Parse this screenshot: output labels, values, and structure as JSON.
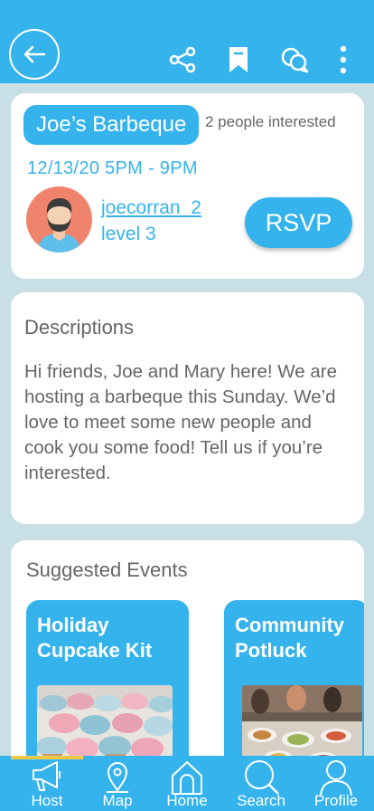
{
  "event": {
    "title": "Joe’s Barbeque",
    "interested": "2 people interested",
    "datetime": "12/13/20 5PM - 9PM",
    "host_username": "joecorran_2",
    "host_level": "level 3",
    "rsvp_label": "RSVP"
  },
  "description": {
    "heading": "Descriptions",
    "body": "Hi friends, Joe and Mary here! We are hosting a barbeque this Sunday. We’d love to meet some new people and cook you some food! Tell us if you’re interested."
  },
  "suggested": {
    "heading": "Suggested Events",
    "items": [
      {
        "title": "Holiday Cupcake Kit"
      },
      {
        "title": "Community Potluck"
      }
    ]
  },
  "nav": {
    "items": [
      {
        "label": "Host",
        "icon": "megaphone-icon"
      },
      {
        "label": "Map",
        "icon": "map-pin-icon"
      },
      {
        "label": "Home",
        "icon": "home-icon"
      },
      {
        "label": "Search",
        "icon": "search-icon"
      },
      {
        "label": "Profile",
        "icon": "profile-icon"
      }
    ],
    "active": "Host"
  },
  "colors": {
    "accent": "#35b3ed",
    "background": "#c9dfe6",
    "active_indicator": "#f2c94c"
  }
}
